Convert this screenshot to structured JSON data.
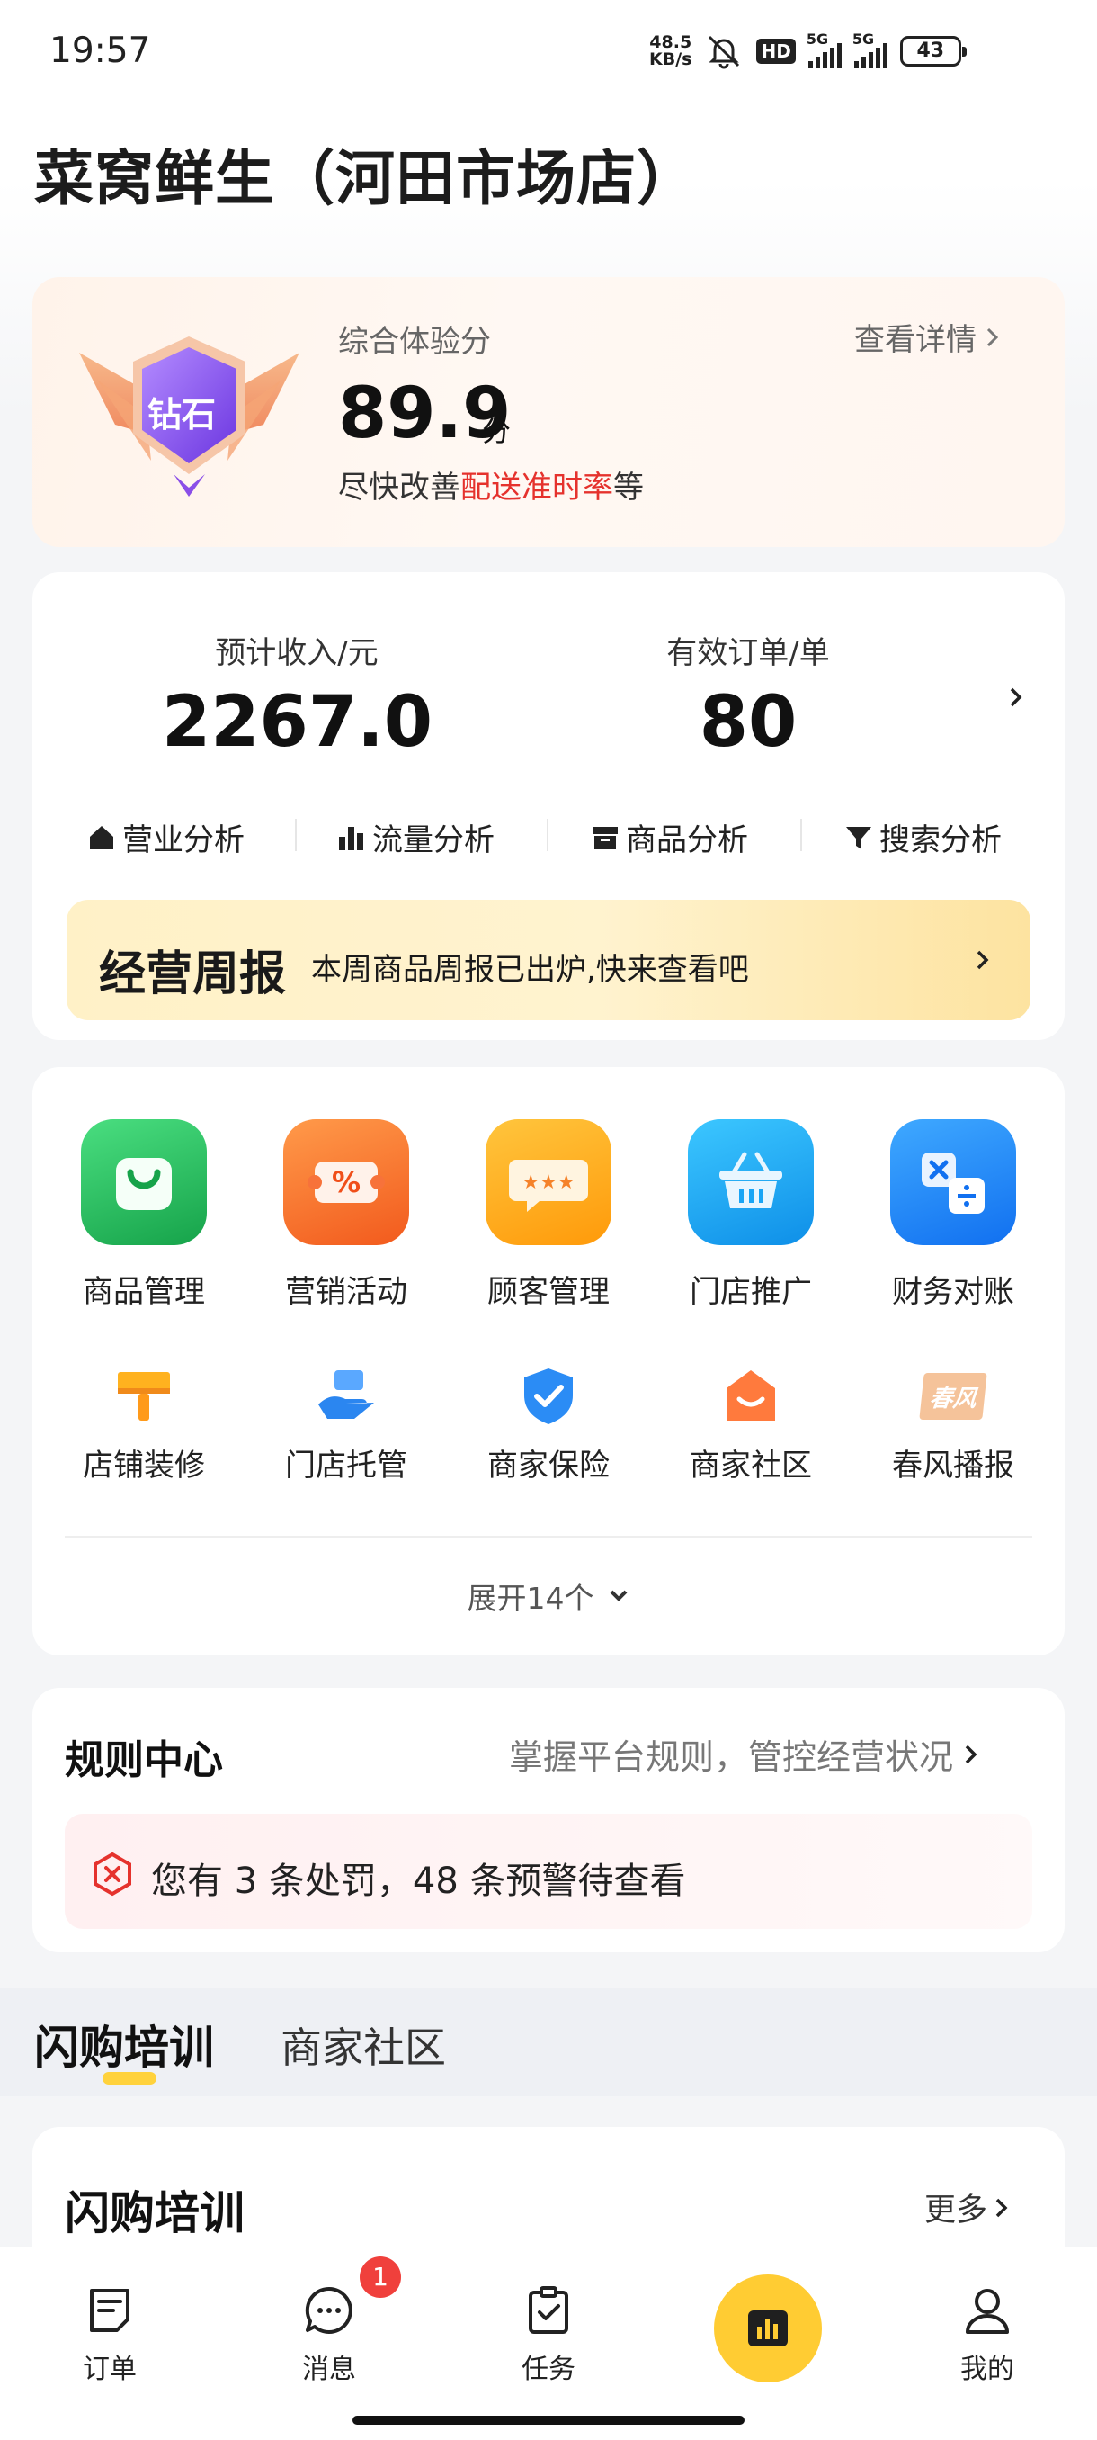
{
  "status_bar": {
    "time": "19:57",
    "net_speed_value": "48.5",
    "net_speed_unit": "KB/s",
    "hd": "HD",
    "signal1": "5G",
    "signal2": "5G",
    "battery": "43"
  },
  "store": {
    "title": "菜窝鲜生（河田市场店）"
  },
  "experience": {
    "badge_text": "钻石",
    "label": "综合体验分",
    "detail_link": "查看详情",
    "score": "89.9",
    "unit": "分",
    "tip_prefix": "尽快改善",
    "tip_highlight": "配送准时率",
    "tip_suffix": "等"
  },
  "stats": {
    "income_label": "预计收入/元",
    "income_value": "2267.0",
    "orders_label": "有效订单/单",
    "orders_value": "80"
  },
  "analysis": [
    {
      "label": "营业分析",
      "icon": "home-icon"
    },
    {
      "label": "流量分析",
      "icon": "bar-chart-icon"
    },
    {
      "label": "商品分析",
      "icon": "box-icon"
    },
    {
      "label": "搜索分析",
      "icon": "funnel-icon"
    }
  ],
  "weekly": {
    "title": "经营周报",
    "desc": "本周商品周报已出炉,快来查看吧"
  },
  "tools_main": [
    {
      "label": "商品管理",
      "icon": "shopping-bag-icon",
      "color": "#22c55e"
    },
    {
      "label": "营销活动",
      "icon": "coupon-icon",
      "color": "#ff6a2a"
    },
    {
      "label": "顾客管理",
      "icon": "chat-rating-icon",
      "color": "#ffa31a"
    },
    {
      "label": "门店推广",
      "icon": "basket-icon",
      "color": "#1aa5f5"
    },
    {
      "label": "财务对账",
      "icon": "calculator-icon",
      "color": "#1f8ef5"
    }
  ],
  "tools_secondary": [
    {
      "label": "店铺装修",
      "icon": "paint-brush-icon"
    },
    {
      "label": "门店托管",
      "icon": "hand-icon"
    },
    {
      "label": "商家保险",
      "icon": "shield-check-icon"
    },
    {
      "label": "商家社区",
      "icon": "community-icon"
    },
    {
      "label": "春风播报",
      "icon": "spring-news-icon",
      "icon_text": "春风"
    }
  ],
  "expand": {
    "label": "展开14个"
  },
  "rules": {
    "title": "规则中心",
    "subtitle": "掌握平台规则，管控经营状况",
    "penalty": "您有 3 条处罚，48 条预警待查看"
  },
  "tabs": [
    {
      "label": "闪购培训"
    },
    {
      "label": "商家社区"
    }
  ],
  "training": {
    "title": "闪购培训",
    "more": "更多"
  },
  "bottom_nav": [
    {
      "label": "订单",
      "icon": "order-icon"
    },
    {
      "label": "消息",
      "icon": "message-icon",
      "badge": "1"
    },
    {
      "label": "任务",
      "icon": "task-icon"
    },
    {
      "label": "",
      "icon": "dashboard-icon"
    },
    {
      "label": "我的",
      "icon": "profile-icon"
    }
  ]
}
